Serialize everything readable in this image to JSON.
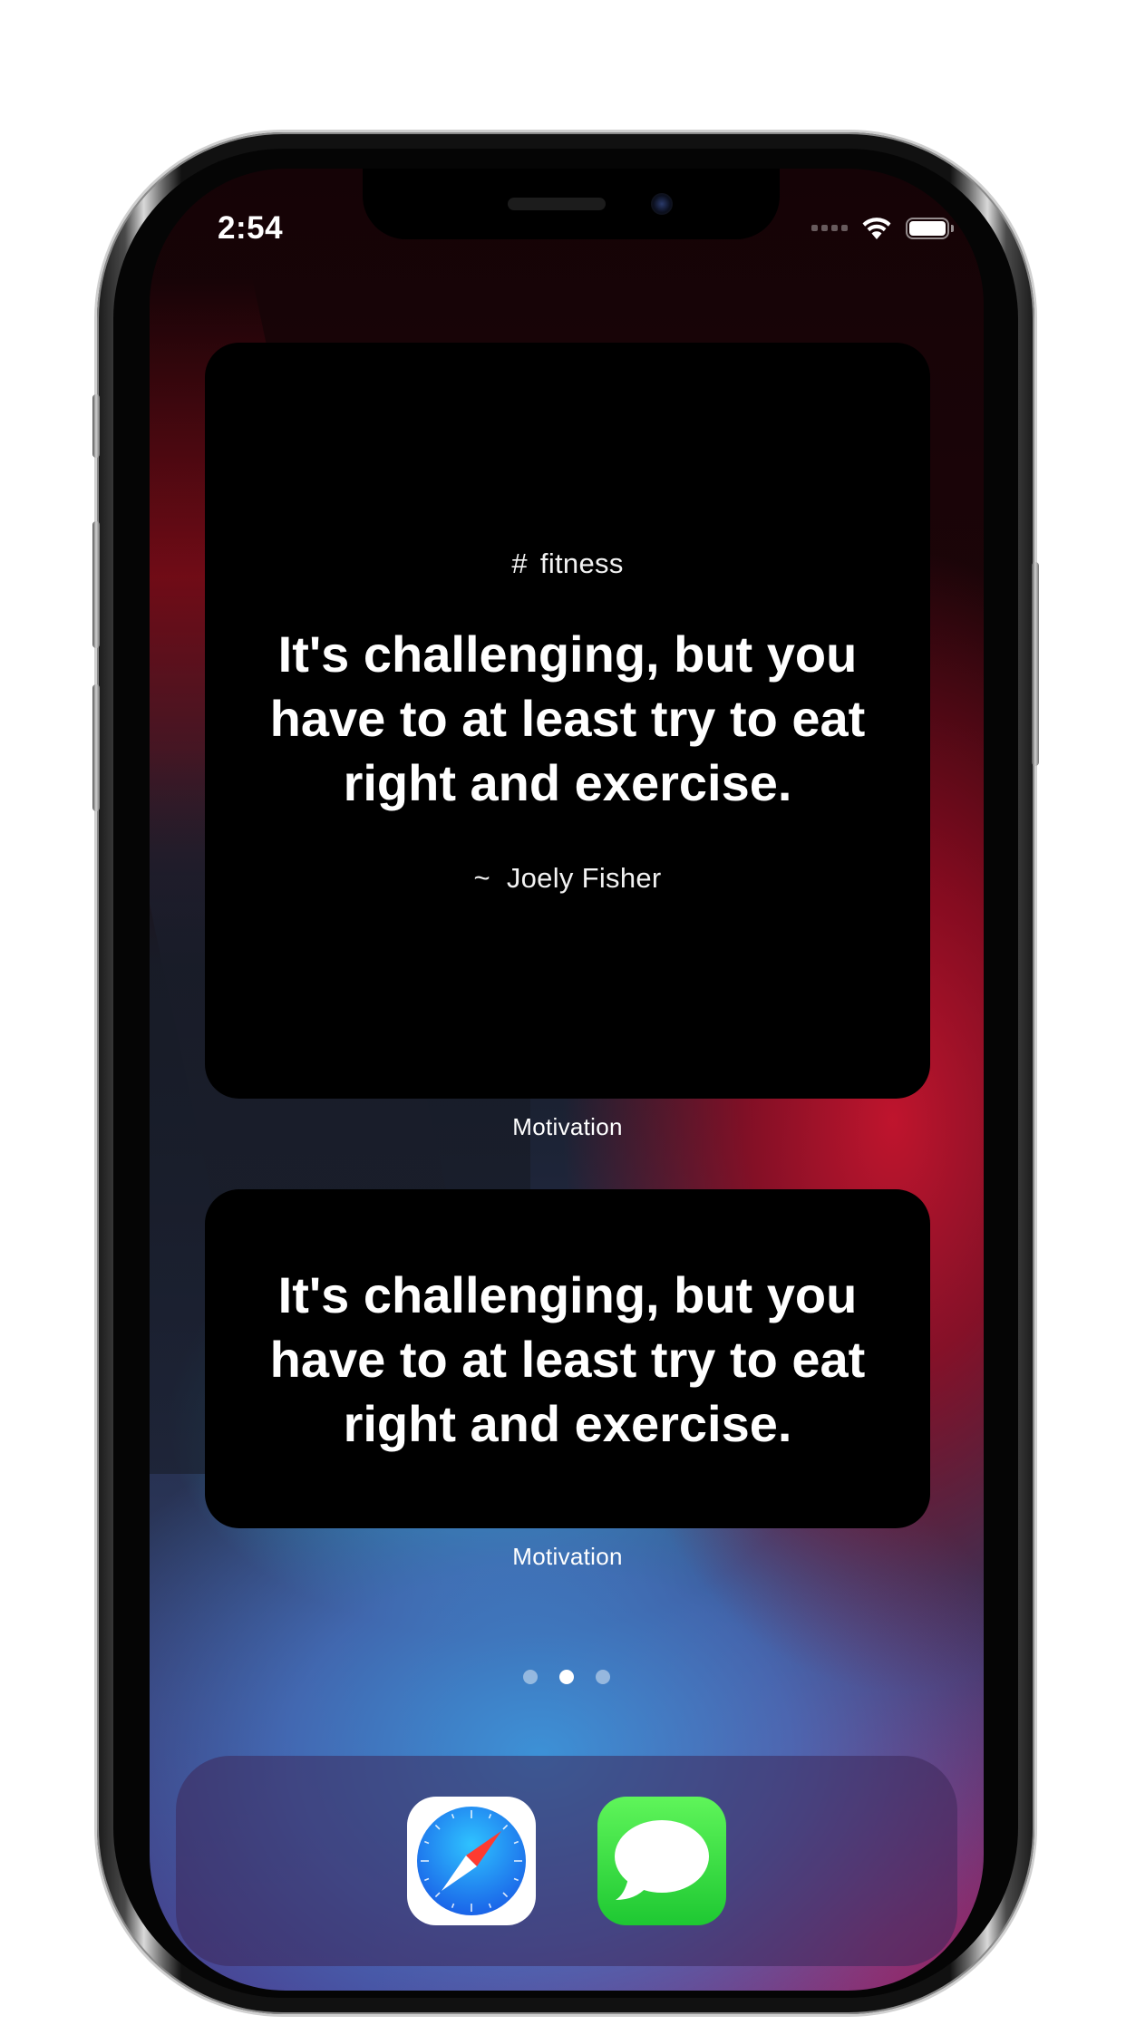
{
  "status_bar": {
    "time": "2:54",
    "wifi_icon": "wifi-icon",
    "battery_icon": "battery-icon",
    "signal_icon": "cellular-signal-icon"
  },
  "widgets": [
    {
      "type": "large",
      "tag_symbol": "#",
      "tag": "fitness",
      "quote": "It's challenging, but you have to at least try to eat right and exercise.",
      "author_symbol": "~",
      "author": "Joely Fisher",
      "caption": "Motivation"
    },
    {
      "type": "medium",
      "quote": "It's challenging, but you have to at least try to eat right and exercise.",
      "caption": "Motivation"
    }
  ],
  "page_indicator": {
    "pages": 3,
    "current": 2
  },
  "dock": {
    "apps": [
      {
        "name": "Safari",
        "icon": "safari-compass-icon"
      },
      {
        "name": "Messages",
        "icon": "messages-bubble-icon"
      }
    ]
  }
}
